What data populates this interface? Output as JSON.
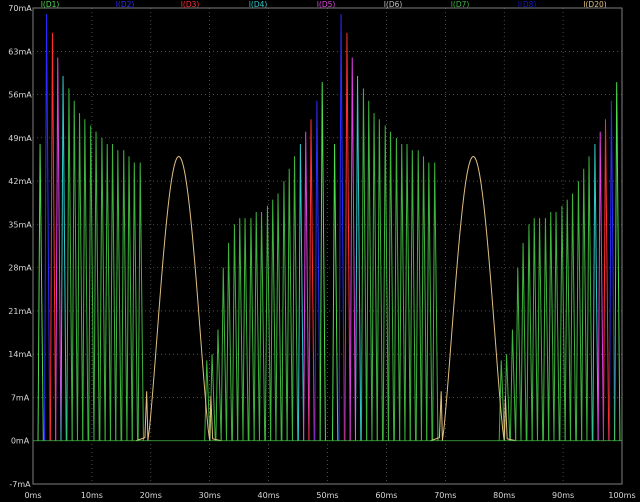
{
  "chart_data": {
    "type": "line",
    "title": "",
    "xlabel": "",
    "ylabel": "",
    "xlim": [
      0,
      100
    ],
    "ylim": [
      -7,
      70
    ],
    "grid": true,
    "legend": "top",
    "x_ticks": [
      "0ms",
      "10ms",
      "20ms",
      "30ms",
      "40ms",
      "50ms",
      "60ms",
      "70ms",
      "80ms",
      "90ms",
      "100ms"
    ],
    "y_ticks": [
      "-7mA",
      "0mA",
      "7mA",
      "14mA",
      "21mA",
      "28mA",
      "35mA",
      "42mA",
      "49mA",
      "56mA",
      "63mA",
      "70mA"
    ],
    "series": [
      {
        "name": "I(D1)",
        "color": "#4fdc4f"
      },
      {
        "name": "I(D2)",
        "color": "#2b2bff"
      },
      {
        "name": "I(D3)",
        "color": "#ff3030"
      },
      {
        "name": "I(D4)",
        "color": "#30c8c8"
      },
      {
        "name": "I(D5)",
        "color": "#e040e0"
      },
      {
        "name": "I(D6)",
        "color": "#c0c0c0"
      },
      {
        "name": "I(D7)",
        "color": "#3fb43f"
      },
      {
        "name": "I(D8)",
        "color": "#1818c0"
      },
      {
        "name": "I(D20)",
        "color": "#e0c080"
      }
    ],
    "pulse_series": {
      "period_ms": 50,
      "spike_times_ms": [
        1.2,
        2.3,
        3.3,
        4.2,
        5.1,
        6.1,
        7.0,
        7.9,
        8.8,
        9.8,
        10.7,
        11.7,
        12.6,
        13.5,
        14.4,
        15.4,
        16.3,
        17.2,
        18.2,
        29.5,
        30.4,
        31.4,
        32.3,
        33.2,
        34.2,
        35.1,
        36.0,
        37.0,
        37.9,
        38.8,
        39.8,
        40.7,
        41.6,
        42.6,
        43.5,
        44.4,
        45.4,
        46.3,
        47.2,
        48.2,
        49.1
      ],
      "spike_peaks_mA": [
        48,
        69,
        66,
        62,
        59,
        57,
        55,
        53,
        52,
        51,
        50,
        49,
        48,
        48,
        47,
        47,
        46,
        45,
        45,
        13,
        14,
        18,
        28,
        32,
        35,
        36,
        36,
        36,
        37,
        37,
        38,
        39,
        40,
        42,
        44,
        46,
        48,
        50,
        52,
        55,
        58
      ]
    },
    "hump_series": {
      "name": "I(D20)",
      "start_ms": 19.5,
      "end_ms": 30,
      "peak_ms": 24.5,
      "peak_mA": 46,
      "small_spike_mA": 8
    }
  }
}
